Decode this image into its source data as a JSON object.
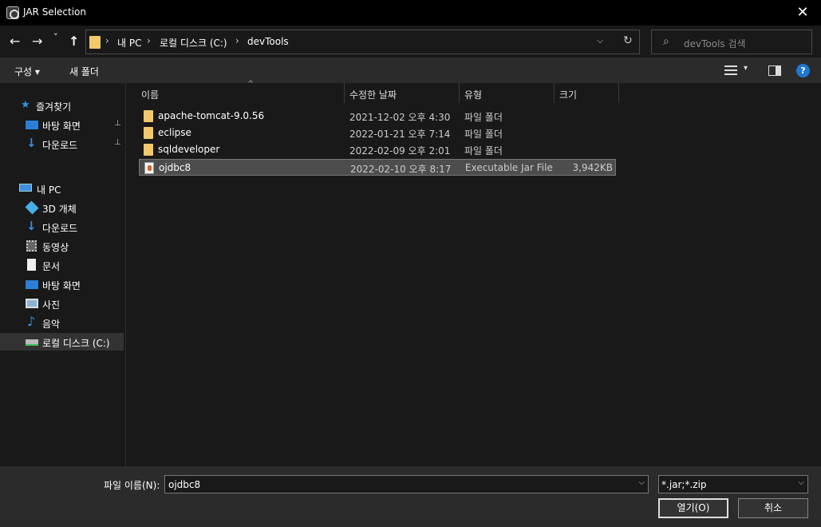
{
  "window": {
    "title": "JAR Selection",
    "close": "✕"
  },
  "nav": {
    "back": "←",
    "forward": "→",
    "recent": "˅",
    "up": "↑",
    "crumbs": [
      "내 PC",
      "로컬 디스크 (C:)",
      "devTools"
    ],
    "sep": "›",
    "dropdown": "⌵",
    "refresh": "↻"
  },
  "search": {
    "icon": "⌕",
    "placeholder": "devTools 검색"
  },
  "toolbar": {
    "organize": "구성 ▾",
    "new_folder": "새 폴더",
    "view_dropdown": "▾",
    "help": "?"
  },
  "sidebar": {
    "items": [
      {
        "label": "즐겨찾기",
        "icon": "star-icon"
      },
      {
        "label": "바탕 화면",
        "icon": "desktop-icon",
        "pinned": true
      },
      {
        "label": "다운로드",
        "icon": "download-icon",
        "pinned": true
      },
      {
        "label": "내 PC",
        "icon": "computer-icon"
      },
      {
        "label": "3D 개체",
        "icon": "cube-icon"
      },
      {
        "label": "다운로드",
        "icon": "download-icon"
      },
      {
        "label": "동영상",
        "icon": "video-icon"
      },
      {
        "label": "문서",
        "icon": "document-icon"
      },
      {
        "label": "바탕 화면",
        "icon": "desktop-icon"
      },
      {
        "label": "사진",
        "icon": "picture-icon"
      },
      {
        "label": "음악",
        "icon": "music-icon"
      },
      {
        "label": "로컬 디스크 (C:)",
        "icon": "drive-icon",
        "selected": true
      }
    ],
    "pin_glyph": "📌"
  },
  "columns": {
    "name": "이름",
    "modified": "수정한 날짜",
    "type": "유형",
    "size": "크기",
    "sort_caret": "^"
  },
  "files": [
    {
      "name": "apache-tomcat-9.0.56",
      "modified": "2021-12-02 오후 4:30",
      "type": "파일 폴더",
      "size": "",
      "kind": "folder"
    },
    {
      "name": "eclipse",
      "modified": "2022-01-21 오후 7:14",
      "type": "파일 폴더",
      "size": "",
      "kind": "folder"
    },
    {
      "name": "sqldeveloper",
      "modified": "2022-02-09 오후 2:01",
      "type": "파일 폴더",
      "size": "",
      "kind": "folder"
    },
    {
      "name": "ojdbc8",
      "modified": "2022-02-10 오후 8:17",
      "type": "Executable Jar File",
      "size": "3,942KB",
      "kind": "jar",
      "selected": true
    }
  ],
  "bottom": {
    "filename_label": "파일 이름(N):",
    "filename_value": "ojdbc8",
    "filter_value": "*.jar;*.zip",
    "dropdown": "⌵",
    "open": "열기(O)",
    "cancel": "취소"
  }
}
